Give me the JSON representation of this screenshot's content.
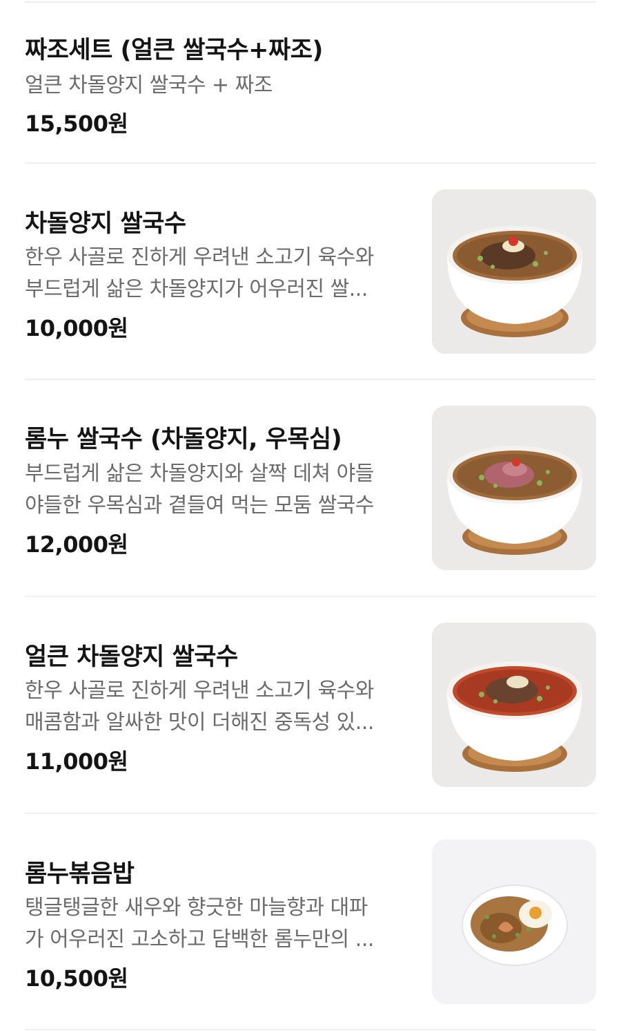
{
  "menu_items": [
    {
      "name": "짜조세트 (얼큰 쌀국수+짜조)",
      "desc_lines": [
        "얼큰 차돌양지 쌀국수 + 짜조"
      ],
      "price": "15,500원",
      "image": null
    },
    {
      "name": "차돌양지 쌀국수",
      "desc_lines": [
        "한우 사골로 진하게 우려낸 소고기 육수와",
        "부드럽게 삶은 차돌양지가 어우러진 쌀..."
      ],
      "price": "10,000원",
      "image": "pho-clear-broth-photo"
    },
    {
      "name": "롬누 쌀국수 (차돌양지, 우목심)",
      "desc_lines": [
        "부드럽게 삶은 차돌양지와 살짝 데쳐 야들",
        "야들한 우목심과 곁들여 먹는 모둠 쌀국수"
      ],
      "price": "12,000원",
      "image": "pho-rare-beef-photo"
    },
    {
      "name": "얼큰 차돌양지 쌀국수",
      "desc_lines": [
        "한우 사골로 진하게 우려낸 소고기 육수와",
        "매콤함과 알싸한 맛이 더해진 중독성 있..."
      ],
      "price": "11,000원",
      "image": "pho-spicy-broth-photo"
    },
    {
      "name": "롬누볶음밥",
      "desc_lines": [
        "탱글탱글한 새우와 향긋한 마늘향과 대파",
        "가 어우러진 고소하고 담백한 롬누만의 ..."
      ],
      "price": "10,500원",
      "image": "fried-rice-photo"
    }
  ]
}
